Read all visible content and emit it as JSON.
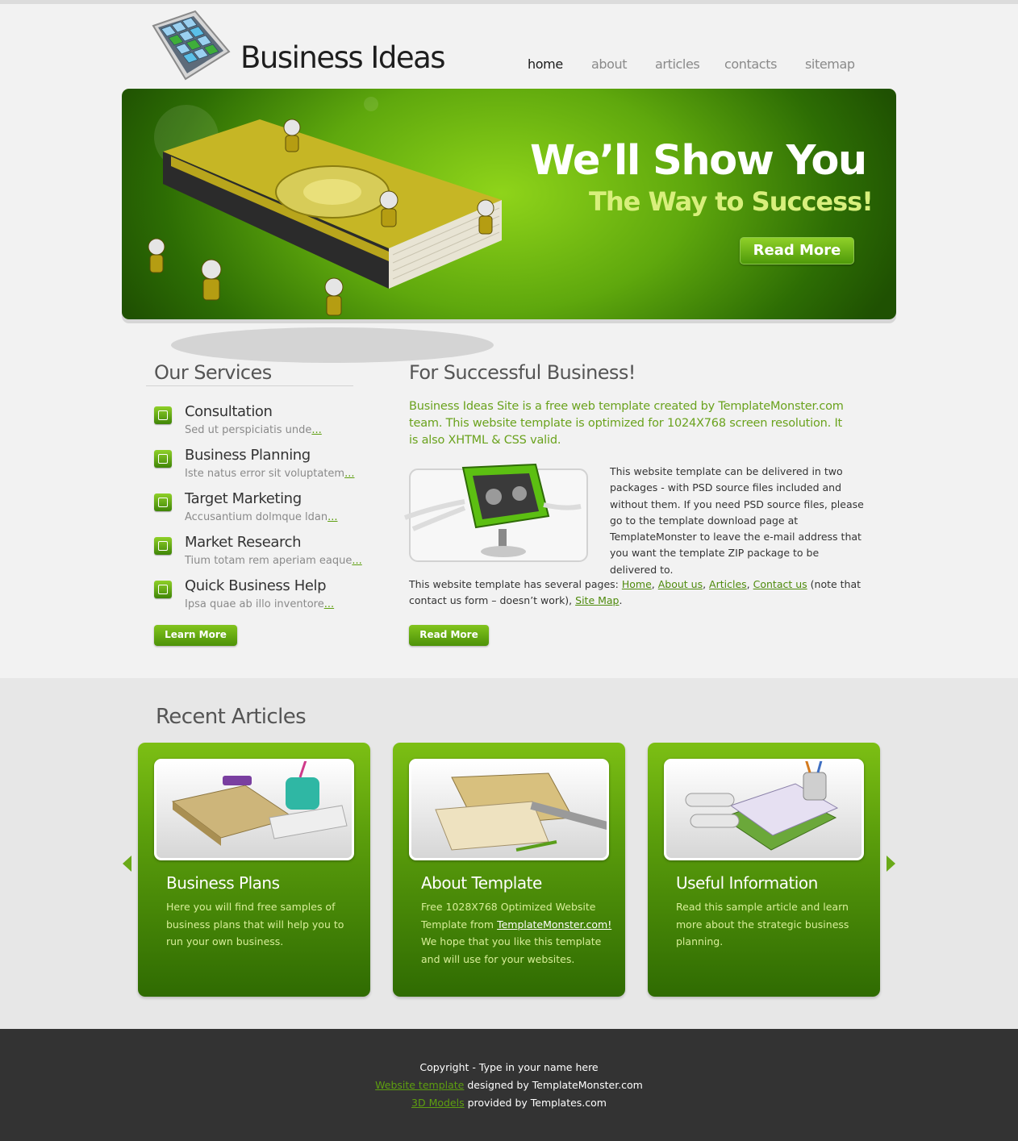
{
  "header": {
    "logo_text": "Business Ideas",
    "nav": [
      {
        "label": "home",
        "active": true
      },
      {
        "label": "about",
        "active": false
      },
      {
        "label": "articles",
        "active": false
      },
      {
        "label": "contacts",
        "active": false
      },
      {
        "label": "sitemap",
        "active": false
      }
    ]
  },
  "hero": {
    "title": "We’ll Show You",
    "subtitle": "The Way to Success!",
    "button_label": "Read More"
  },
  "services": {
    "title": "Our Services",
    "items": [
      {
        "name": "Consultation",
        "desc": "Sed ut perspiciatis unde",
        "more": "...",
        "icon": "consultation-icon"
      },
      {
        "name": "Business Planning",
        "desc": "Iste natus error sit voluptatem",
        "more": "...",
        "icon": "calendar-icon"
      },
      {
        "name": "Target Marketing",
        "desc": "Accusantium dolmque ldan",
        "more": "...",
        "icon": "target-marketing-icon"
      },
      {
        "name": "Market Research",
        "desc": "Tium totam rem aperiam eaque",
        "more": "...",
        "icon": "market-research-icon"
      },
      {
        "name": "Quick Business Help",
        "desc": "Ipsa quae ab illo inventore",
        "more": "...",
        "icon": "handshake-icon"
      }
    ],
    "button_label": "Learn More"
  },
  "business": {
    "title": "For Successful Business!",
    "lead": "Business Ideas Site is a free web template created by TemplateMonster.com team. This website template is optimized for 1024X768 screen resolution. It is also XHTML & CSS valid.",
    "para1": "This website template can be delivered in two packages - with PSD source files included and without them. If you need PSD source files, please go to the template download page at TemplateMonster to leave the e-mail address that you want the template ZIP package to be delivered to.",
    "para2_intro": "This website template has several pages: ",
    "links": [
      "Home",
      "About us",
      "Articles",
      "Contact us",
      "Site Map"
    ],
    "para2_note": " (note that contact us form – doesn’t work), ",
    "button_label": "Read More"
  },
  "articles": {
    "title": "Recent Articles",
    "cards": [
      {
        "title": "Business Plans",
        "text": "Here you will find free samples of business plans that will help you to run your own business."
      },
      {
        "title": "About Template",
        "text_before": "Free 1028X768 Optimized Website Template from ",
        "link": "TemplateMonster.com!",
        "text_after": " We hope that you like this template and will use for your websites."
      },
      {
        "title": "Useful Information",
        "text": "Read this sample article and learn more about the strategic business planning."
      }
    ]
  },
  "footer": {
    "copyright": "Copyright - Type in your name here",
    "line2_link": "Website template",
    "line2_text": " designed by TemplateMonster.com",
    "line3_link": "3D Models",
    "line3_text": " provided by Templates.com"
  },
  "colors": {
    "accent": "#6aaa18",
    "dark_green": "#2f6b02",
    "footer_bg": "#333333"
  }
}
